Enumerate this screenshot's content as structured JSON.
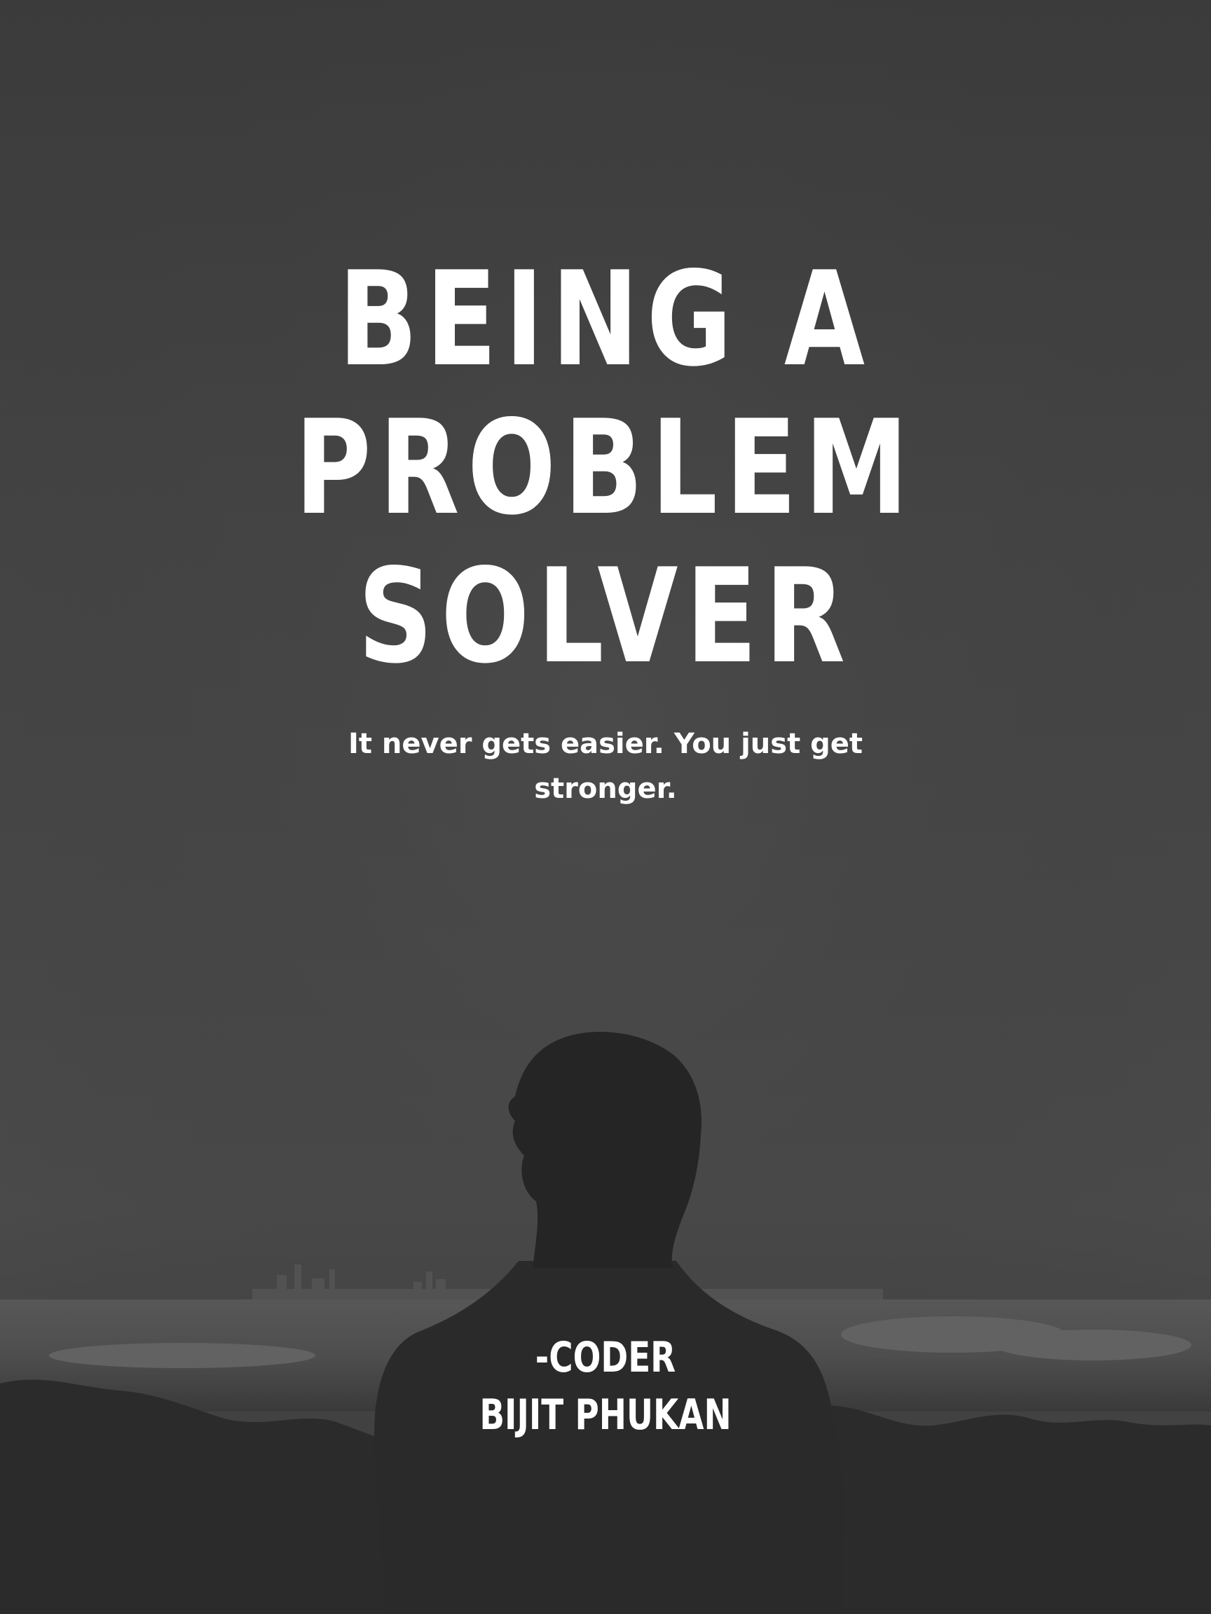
{
  "poster": {
    "title_lines": [
      "BEING A",
      "PROBLEM",
      "SOLVER"
    ],
    "subtitle": "It never gets easier. You just get stronger.",
    "credit_role": "-CODER",
    "credit_name": "BIJIT PHUKAN"
  },
  "colors": {
    "text": "#ffffff",
    "sky": "#474747",
    "silhouette": "#242424"
  }
}
